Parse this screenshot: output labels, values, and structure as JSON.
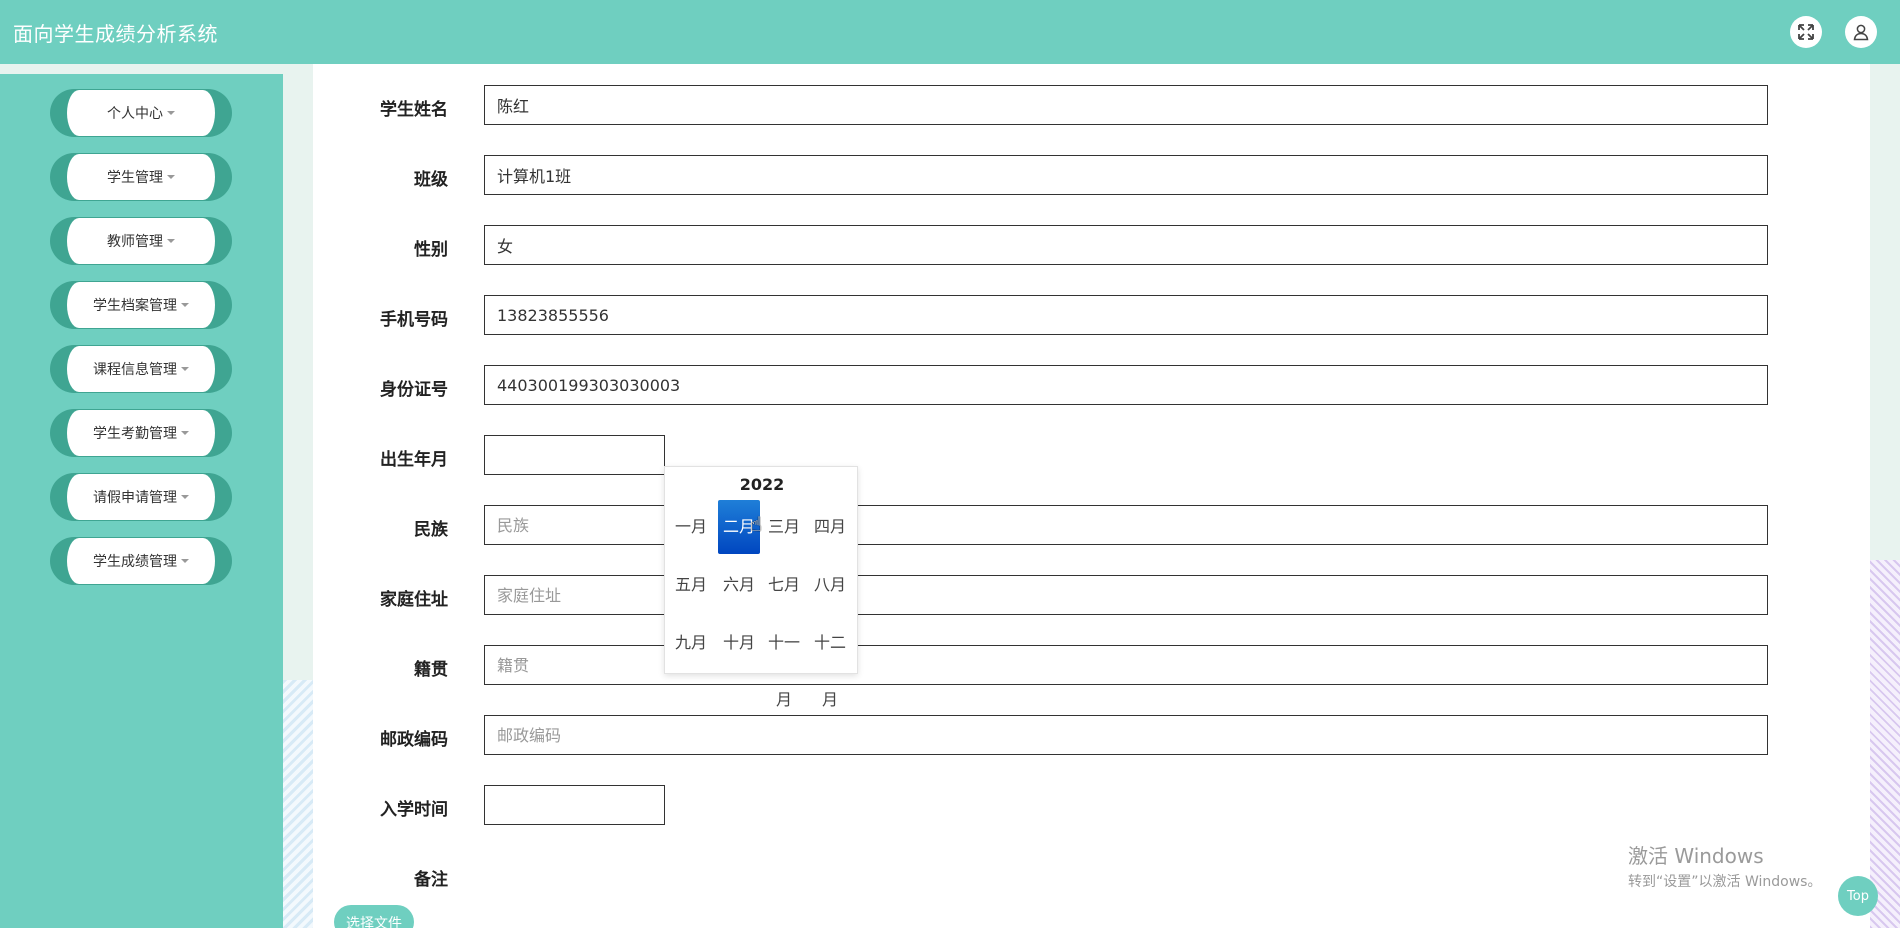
{
  "header": {
    "title": "面向学生成绩分析系统",
    "fullscreen_icon": "fullscreen-icon",
    "user_icon": "user-icon"
  },
  "sidebar": {
    "items": [
      {
        "label": "个人中心"
      },
      {
        "label": "学生管理"
      },
      {
        "label": "教师管理"
      },
      {
        "label": "学生档案管理"
      },
      {
        "label": "课程信息管理"
      },
      {
        "label": "学生考勤管理"
      },
      {
        "label": "请假申请管理"
      },
      {
        "label": "学生成绩管理"
      }
    ]
  },
  "form": {
    "name": {
      "label": "学生姓名",
      "value": "陈红"
    },
    "class": {
      "label": "班级",
      "value": "计算机1班"
    },
    "gender": {
      "label": "性别",
      "value": "女"
    },
    "phone": {
      "label": "手机号码",
      "value": "13823855556"
    },
    "id_number": {
      "label": "身份证号",
      "value": "440300199303030003"
    },
    "birth": {
      "label": "出生年月",
      "value": ""
    },
    "ethnicity": {
      "label": "民族",
      "placeholder": "民族"
    },
    "address": {
      "label": "家庭住址",
      "placeholder": "家庭住址"
    },
    "hometown": {
      "label": "籍贯",
      "placeholder": "籍贯"
    },
    "postcode": {
      "label": "邮政编码",
      "placeholder": "邮政编码"
    },
    "enroll": {
      "label": "入学时间",
      "value": ""
    },
    "remark": {
      "label": "备注"
    },
    "file_button": "选择文件"
  },
  "month_picker": {
    "year": "2022",
    "months": [
      "一月",
      "二月",
      "三月",
      "四月",
      "五月",
      "六月",
      "七月",
      "八月",
      "九月",
      "十月",
      "十一",
      "十二"
    ],
    "overflow": [
      "月",
      "月"
    ],
    "selected_month": "二月"
  },
  "watermark": {
    "title": "激活 Windows",
    "subtitle": "转到“设置”以激活 Windows。"
  },
  "top_button": "Top",
  "colors": {
    "primary": "#6fcfc0",
    "menu_pill": "#3fa592",
    "selected": "#0052cc"
  }
}
